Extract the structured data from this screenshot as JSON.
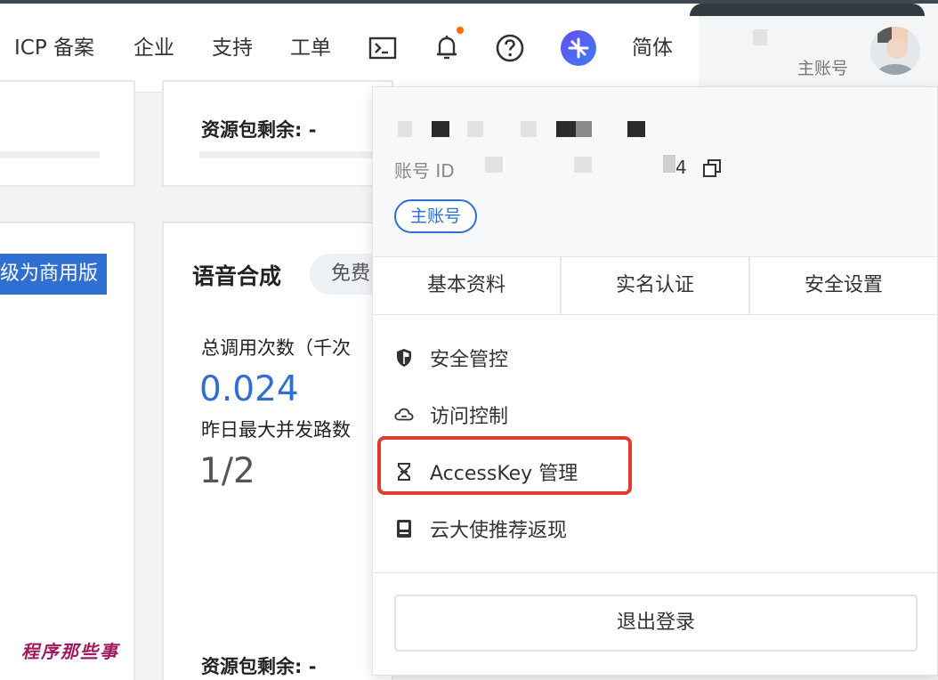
{
  "header": {
    "nav": [
      "ICP 备案",
      "企业",
      "支持",
      "工单"
    ],
    "lang": "简体",
    "account_label": "主账号"
  },
  "cards": {
    "left_top_remaining": "资源包剩余: -",
    "upgrade_label": "级为商用版",
    "tts": {
      "title": "语音合成",
      "tag": "免费",
      "calls_label": "总调用次数（千次",
      "calls_value": "0.024",
      "concurrency_label": "昨日最大并发路数",
      "concurrency_value": "1/2",
      "remaining": "资源包剩余: -"
    }
  },
  "dropdown": {
    "id_label": "账号 ID",
    "id_tail": "4",
    "role_tag": "主账号",
    "tabs": [
      "基本资料",
      "实名认证",
      "安全设置"
    ],
    "menu": [
      {
        "label": "安全管控",
        "icon": "shield-icon"
      },
      {
        "label": "访问控制",
        "icon": "cloud-icon"
      },
      {
        "label": "AccessKey 管理",
        "icon": "key-icon"
      },
      {
        "label": "云大使推荐返现",
        "icon": "gift-card-icon"
      }
    ],
    "logout": "退出登录"
  },
  "watermark": "程序那些事",
  "colors": {
    "accent": "#2f6fd1",
    "highlight": "#e23a2c",
    "notify": "#ff6a00"
  }
}
